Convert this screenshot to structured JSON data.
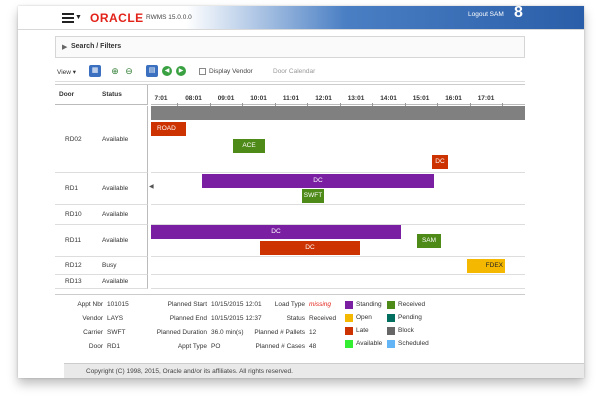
{
  "header": {
    "logo": "ORACLE",
    "version": "RWMS 15.0.0.0",
    "logout": "Logout SAM",
    "user_glyph": "8"
  },
  "search": {
    "label": "Search / Filters",
    "toggle_icon": "triangle-right-icon"
  },
  "toolbar": {
    "view_label": "View ▾",
    "display_vendor_label": "Display Vendor",
    "door_calendar_label": "Door Calendar",
    "display_vendor_checked": false
  },
  "grid": {
    "door_header": "Door",
    "status_header": "Status",
    "times": [
      "7:01",
      "08:01",
      "09:01",
      "10:01",
      "11:01",
      "12:01",
      "13:01",
      "14:01",
      "15:01",
      "16:01",
      "17:01"
    ],
    "rows": [
      {
        "door": "RD02",
        "status": "Available"
      },
      {
        "door": "RD1",
        "status": "Available"
      },
      {
        "door": "RD10",
        "status": "Available"
      },
      {
        "door": "RD11",
        "status": "Available"
      },
      {
        "door": "RD12",
        "status": "Busy"
      },
      {
        "door": "RD13",
        "status": "Available"
      }
    ],
    "appointments": [
      {
        "label": "ROAD",
        "status": "Late",
        "color": "#cc3300"
      },
      {
        "label": "ACE",
        "status": "Received",
        "color": "#4e8a18"
      },
      {
        "label": "DC",
        "status": "Late",
        "color": "#cc3300"
      },
      {
        "label": "DC",
        "status": "Standing",
        "color": "#7b1fa2"
      },
      {
        "label": "SWFT",
        "status": "Received",
        "color": "#4e8a18"
      },
      {
        "label": "DC",
        "status": "Standing",
        "color": "#7b1fa2"
      },
      {
        "label": "SAM",
        "status": "Received",
        "color": "#4e8a18"
      },
      {
        "label": "DC",
        "status": "Late",
        "color": "#cc3300"
      },
      {
        "label": "FDEX",
        "status": "Open",
        "color": "#f5b800"
      }
    ]
  },
  "details": {
    "appt_nbr_label": "Appt Nbr",
    "appt_nbr": "101015",
    "vendor_label": "Vendor",
    "vendor": "LAYS",
    "carrier_label": "Carrier",
    "carrier": "SWFT",
    "door_label": "Door",
    "door": "RD1",
    "planned_start_label": "Planned Start",
    "planned_start": "10/15/2015 12:01",
    "planned_end_label": "Planned End",
    "planned_end": "10/15/2015 12:37",
    "planned_duration_label": "Planned Duration",
    "planned_duration": "36.0 min(s)",
    "appt_type_label": "Appt Type",
    "appt_type": "PO",
    "load_type_label": "Load Type",
    "load_type": "missing",
    "status_label": "Status",
    "status": "Received",
    "pallets_label": "Planned # Pallets",
    "pallets": "12",
    "cases_label": "Planned # Cases",
    "cases": "48"
  },
  "legend": [
    {
      "label": "Standing",
      "color": "#7b1fa2"
    },
    {
      "label": "Received",
      "color": "#4e8a18"
    },
    {
      "label": "Open",
      "color": "#f5b800"
    },
    {
      "label": "Pending",
      "color": "#006f5f"
    },
    {
      "label": "Late",
      "color": "#cc3300"
    },
    {
      "label": "Block",
      "color": "#666666"
    },
    {
      "label": "Available",
      "color": "#33ee33"
    },
    {
      "label": "Scheduled",
      "color": "#64b5f6"
    }
  ],
  "footer": {
    "copyright": "Copyright (C) 1998, 2015, Oracle and/or its affiliates. All rights reserved."
  }
}
